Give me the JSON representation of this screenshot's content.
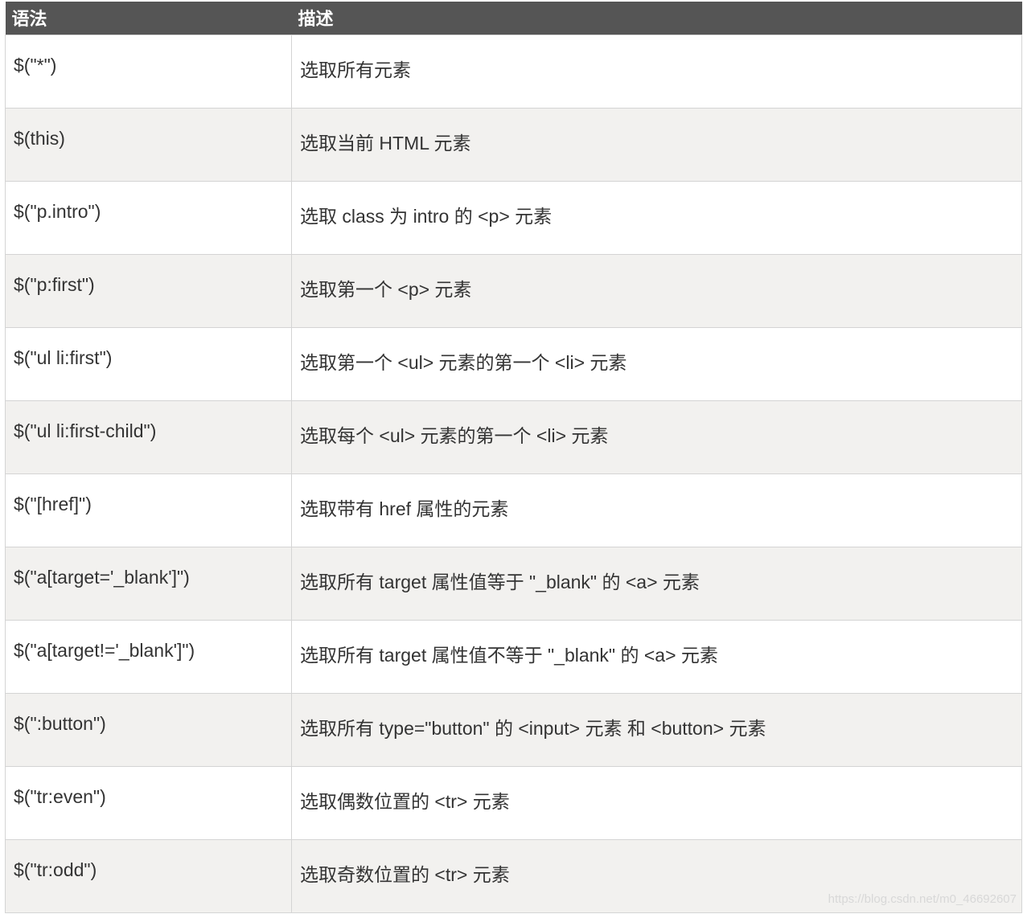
{
  "table": {
    "headers": [
      "语法",
      "描述"
    ],
    "rows": [
      {
        "syntax": "$(\"*\")",
        "description": "选取所有元素"
      },
      {
        "syntax": "$(this)",
        "description": "选取当前 HTML 元素"
      },
      {
        "syntax": "$(\"p.intro\")",
        "description": "选取 class 为 intro 的 <p> 元素"
      },
      {
        "syntax": "$(\"p:first\")",
        "description": "选取第一个 <p> 元素"
      },
      {
        "syntax": "$(\"ul li:first\")",
        "description": "选取第一个 <ul> 元素的第一个 <li> 元素"
      },
      {
        "syntax": "$(\"ul li:first-child\")",
        "description": "选取每个 <ul> 元素的第一个 <li> 元素"
      },
      {
        "syntax": "$(\"[href]\")",
        "description": "选取带有 href 属性的元素"
      },
      {
        "syntax": "$(\"a[target='_blank']\")",
        "description": "选取所有 target 属性值等于 \"_blank\" 的 <a> 元素"
      },
      {
        "syntax": "$(\"a[target!='_blank']\")",
        "description": "选取所有 target 属性值不等于 \"_blank\" 的 <a> 元素"
      },
      {
        "syntax": "$(\":button\")",
        "description": "选取所有 type=\"button\" 的 <input> 元素 和 <button> 元素"
      },
      {
        "syntax": "$(\"tr:even\")",
        "description": "选取偶数位置的 <tr> 元素"
      },
      {
        "syntax": "$(\"tr:odd\")",
        "description": "选取奇数位置的 <tr> 元素"
      }
    ]
  },
  "watermark": "https://blog.csdn.net/m0_46692607",
  "colors": {
    "header_bg": "#555555",
    "header_text": "#ffffff",
    "row_alt_bg": "#f2f1ef",
    "border": "#d4d4d4"
  }
}
